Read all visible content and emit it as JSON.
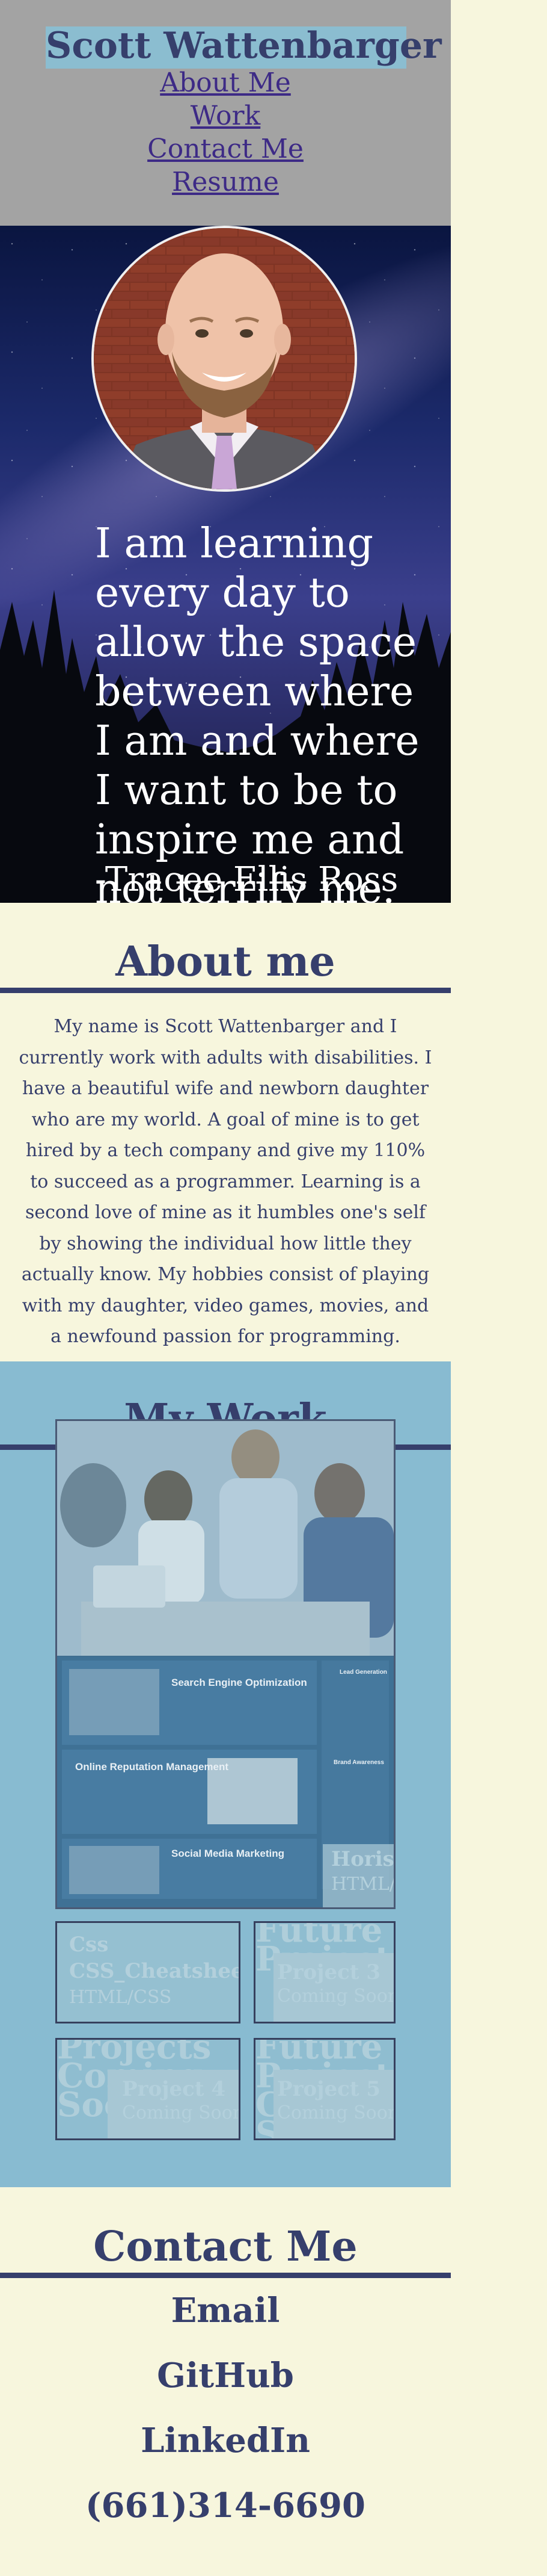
{
  "header": {
    "name": "Scott Wattenbarger",
    "nav": [
      "About Me",
      "Work",
      "Contact Me",
      "Resume"
    ]
  },
  "hero": {
    "quote": "I am learning every day to allow the space between where I am and where I want to be to inspire me and not terrify me.",
    "author": "-Tracee Ellis Ross"
  },
  "about": {
    "title": "About me",
    "text": "My name is Scott Wattenbarger and I currently work with adults with disabilities. I have a beautiful wife and newborn daughter who are my world. A goal of mine is to get hired by a tech company and give my 110% to succeed as a programmer. Learning is a second love of mine as it humbles one's self by showing the individual how little they actually know. My hobbies consist of playing with my daughter, video games, movies, and a newfound passion for programming."
  },
  "work": {
    "title": "My Work",
    "featured": {
      "title": "Horiseon",
      "sub": "HTML/CSS",
      "preview": {
        "seo_title": "Search Engine Optimization",
        "orm_title": "Online Reputation Management",
        "smm_title": "Social Media Marketing",
        "lead_title": "Lead Generation",
        "brand_title": "Brand Awareness"
      }
    },
    "projects": [
      {
        "bg": "Css",
        "title": "CSS_Cheatsheet",
        "sub": "HTML/CSS"
      },
      {
        "bg": "Future Projects",
        "title": "Project 3",
        "sub": "Coming Soon"
      },
      {
        "bg": "Projects Coming Soon",
        "title": "Project 4",
        "sub": "Coming Soon"
      },
      {
        "bg": "Future Projects Coming Soon",
        "title": "Project 5",
        "sub": "Coming Soon"
      }
    ]
  },
  "contact": {
    "title": "Contact Me",
    "links": [
      "Email",
      "GitHub",
      "LinkedIn",
      "(661)314-6690"
    ]
  },
  "colors": {
    "background": "#f7f6dd",
    "header_bg": "#a3a3a3",
    "accent": "#363f6c",
    "work_bg": "#88bbd1",
    "name_highlight": "#8bbdd0",
    "nav_link": "#3d2a86"
  }
}
